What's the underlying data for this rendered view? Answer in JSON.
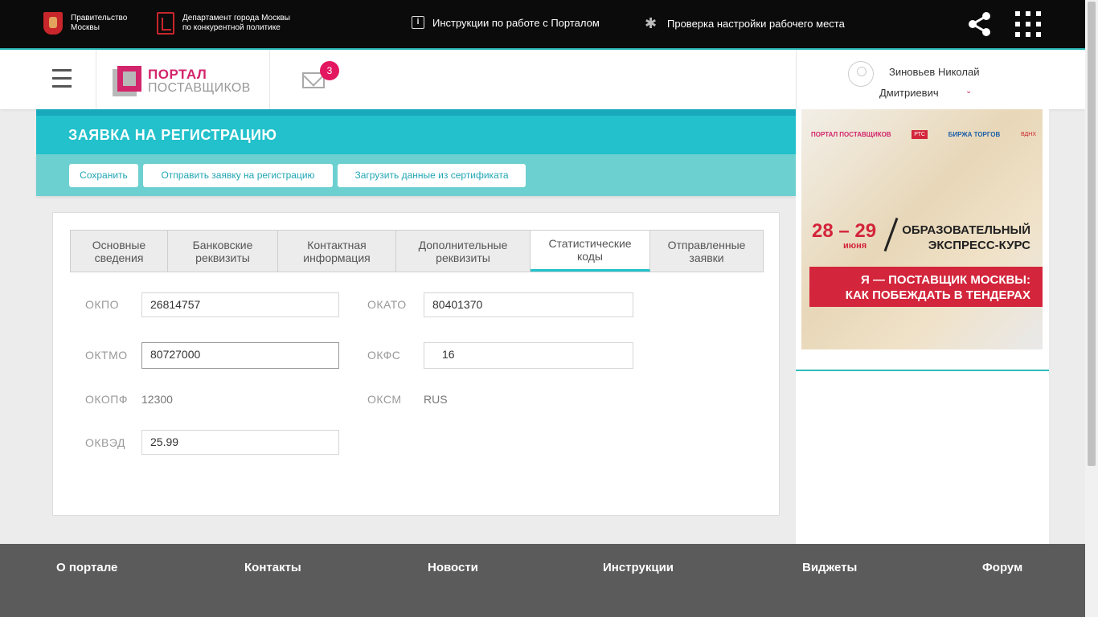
{
  "topbar": {
    "org1_line1": "Правительство",
    "org1_line2": "Москвы",
    "org2_line1": "Департамент города Москвы",
    "org2_line2": "по конкурентной политике",
    "instructions_link": "Инструкции по работе с Порталом",
    "workplace_check_link": "Проверка настройки рабочего места",
    "info_glyph": "i",
    "gear_glyph": "✱",
    "icons": [
      "moscow-emblem-icon",
      "department-logo-icon",
      "info-icon",
      "gear-icon",
      "share-icon",
      "apps-grid-icon"
    ]
  },
  "header": {
    "logo_line1": "ПОРТАЛ",
    "logo_line2": "ПОСТАВЩИКОВ",
    "mail_count": "3",
    "user_name_line1": "Зиновьев Николай",
    "user_name_line2": "Дмитриевич",
    "user_menu_glyph": "⌄"
  },
  "panel": {
    "title": "ЗАЯВКА НА РЕГИСТРАЦИЮ",
    "buttons": {
      "save": "Сохранить",
      "send": "Отправить заявку на регистрацию",
      "load_cert": "Загрузить данные из сертификата"
    }
  },
  "tabs": [
    {
      "line1": "Основные",
      "line2": "сведения"
    },
    {
      "line1": "Банковские",
      "line2": "реквизиты"
    },
    {
      "line1": "Контактная",
      "line2": "информация"
    },
    {
      "line1": "Дополнительные",
      "line2": "реквизиты"
    },
    {
      "line1": "Статистические",
      "line2": "коды"
    },
    {
      "line1": "Отправленные",
      "line2": "заявки"
    }
  ],
  "active_tab": "Статистические коды",
  "fields": {
    "okpo": {
      "label": "ОКПО",
      "value": "26814757"
    },
    "okato": {
      "label": "ОКАТО",
      "value": "80401370"
    },
    "oktmo": {
      "label": "ОКТМО",
      "value": "80727000"
    },
    "okfs": {
      "label": "ОКФС",
      "value": "16"
    },
    "okopf": {
      "label": "ОКОПФ",
      "value": "12300"
    },
    "oksm": {
      "label": "ОКСМ",
      "value": "RUS"
    },
    "okved": {
      "label": "ОКВЭД",
      "value": "25.99"
    }
  },
  "banner": {
    "logo1": "ПОРТАЛ ПОСТАВЩИКОВ",
    "logo2": "РТС",
    "logo3": "БИРЖА ТОРГОВ",
    "logo4": "ВДНХ",
    "dates": "28 – 29",
    "month": "июня",
    "course_line1": "ОБРАЗОВАТЕЛЬНЫЙ",
    "course_line2": "ЭКСПРЕСС-КУРС",
    "slogan_line1": "Я — ПОСТАВЩИК МОСКВЫ:",
    "slogan_line2": "КАК ПОБЕЖДАТЬ В ТЕНДЕРАХ"
  },
  "footer": {
    "links": [
      "О портале",
      "Контакты",
      "Новости",
      "Инструкции",
      "Виджеты",
      "Форум"
    ]
  },
  "colors": {
    "teal": "#22c1cb",
    "teal_light": "#6cd0d0",
    "brand_pink": "#d3256b",
    "badge": "#e2175f",
    "footer_bg": "#5b5b5b",
    "topbar_bg": "#0b0b0b"
  }
}
